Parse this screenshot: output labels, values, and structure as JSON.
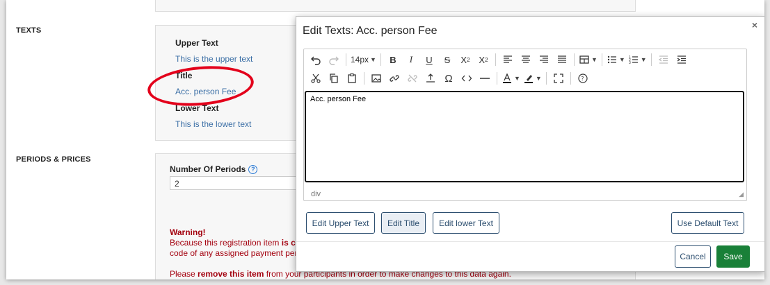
{
  "background": {
    "sections": {
      "texts_label": "TEXTS",
      "periods_label": "PERIODS & PRICES"
    },
    "texts_card": {
      "upper_label": "Upper Text",
      "upper_value": "This is the upper text",
      "title_label": "Title",
      "title_value": "Acc. person Fee",
      "lower_label": "Lower Text",
      "lower_value": "This is the lower text"
    },
    "periods_card": {
      "num_periods_label": "Number Of Periods",
      "num_periods_value": "2"
    },
    "warning": {
      "title": "Warning!",
      "line1_a": "Because this registration item ",
      "line1_b": "is cu",
      "line2": "code of any assigned payment peri",
      "line3_a": "Please ",
      "line3_b": "remove this item",
      "line3_c": " from your participants in order to make changes to this data again."
    }
  },
  "modal": {
    "title": "Edit Texts: Acc. person Fee",
    "close_symbol": "×",
    "toolbar": {
      "font_size": "14px"
    },
    "editor_content": "Acc. person Fee",
    "status_path": "div",
    "buttons": {
      "edit_upper": "Edit Upper Text",
      "edit_title": "Edit Title",
      "edit_lower": "Edit lower Text",
      "use_default": "Use Default Text",
      "cancel": "Cancel",
      "save": "Save"
    }
  },
  "colors": {
    "accent_red": "#e3001b",
    "save_green": "#198038",
    "link_blue": "#3a6ea5",
    "warning_red": "#a3000e"
  }
}
